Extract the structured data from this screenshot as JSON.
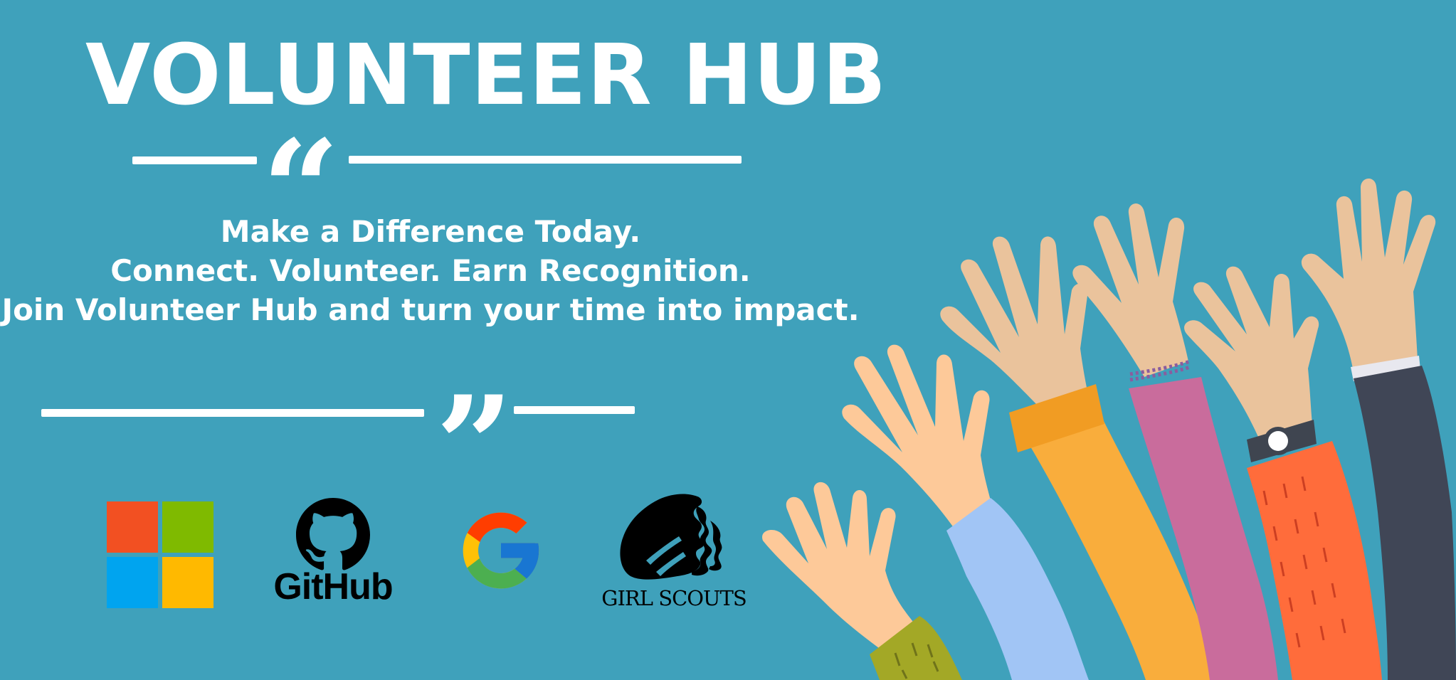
{
  "banner": {
    "title": "VOLUNTEER HUB",
    "opening_quote": "“",
    "closing_quote": "”",
    "tagline_lines": [
      "Make a Difference Today.",
      "Connect. Volunteer. Earn Recognition.",
      "Join Volunteer Hub and turn your time into impact."
    ],
    "background_color": "#3fa1bb"
  },
  "partners": [
    {
      "name": "Microsoft",
      "icon": "microsoft-logo-icon"
    },
    {
      "name": "GitHub",
      "icon": "github-logo-icon",
      "wordmark": "GitHub"
    },
    {
      "name": "Google",
      "icon": "google-logo-icon"
    },
    {
      "name": "Girl Scouts",
      "icon": "girl-scouts-logo-icon",
      "wordmark": "GIRL SCOUTS"
    }
  ],
  "illustration": {
    "icon": "raised-hands-illustration"
  }
}
